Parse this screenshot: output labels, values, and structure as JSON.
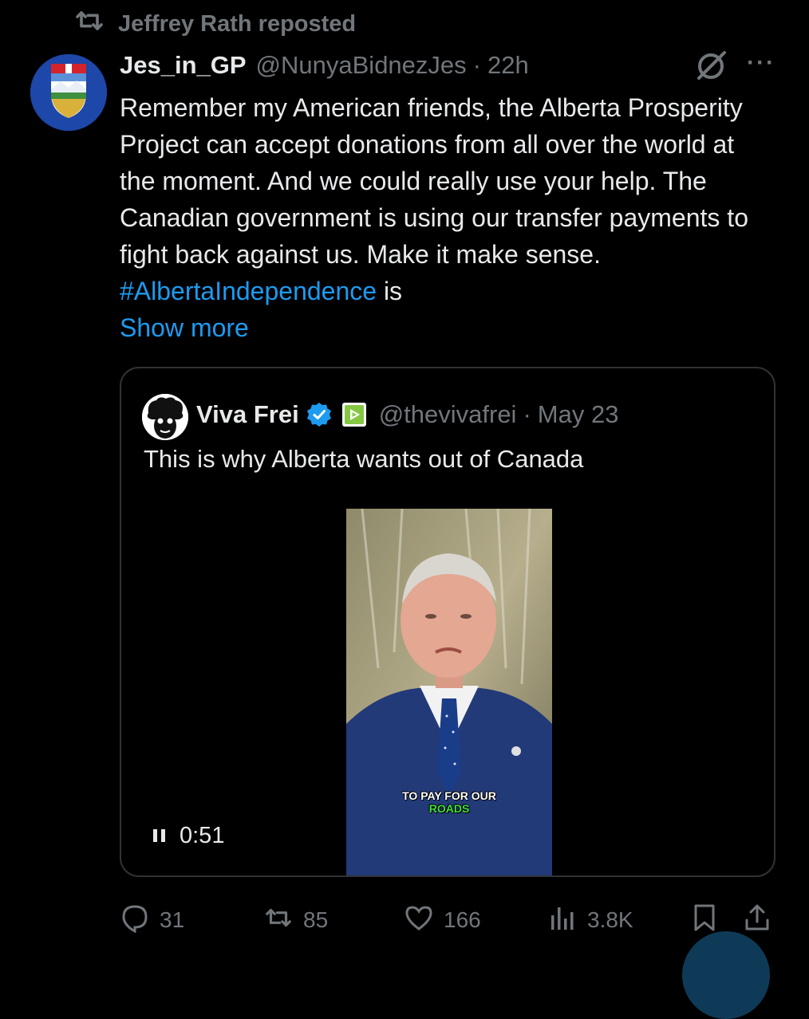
{
  "repost": {
    "label": "Jeffrey Rath reposted",
    "icon": "repost-icon"
  },
  "tweet": {
    "name": "Jes_in_GP",
    "handle": "@NunyaBidnezJes",
    "separator": "·",
    "time": "22h",
    "text_main": "Remember my American friends, the Alberta Prosperity Project can accept donations from all over the world at the moment. And we could really use your help. The Canadian government is using our transfer payments to fight back against us. Make it make sense. ",
    "hashtag": "#AlbertaIndependence",
    "text_after": " is",
    "show_more": "Show more",
    "avatar": "alberta-coat-of-arms",
    "more": "···"
  },
  "quote": {
    "name": "Viva Frei",
    "handle": "@thevivafrei",
    "separator": "·",
    "date": "May 23",
    "text": "This is why Alberta wants out of Canada",
    "video": {
      "caption_line1": "TO PAY FOR OUR",
      "caption_line2": "ROADS",
      "duration": "0:51",
      "state": "playing"
    }
  },
  "actions": {
    "replies": "31",
    "reposts": "85",
    "likes": "166",
    "views": "3.8K"
  },
  "colors": {
    "background": "#000000",
    "text": "#e7e9ea",
    "muted": "#71767b",
    "link": "#1d9bf0",
    "border": "#2f3336"
  }
}
